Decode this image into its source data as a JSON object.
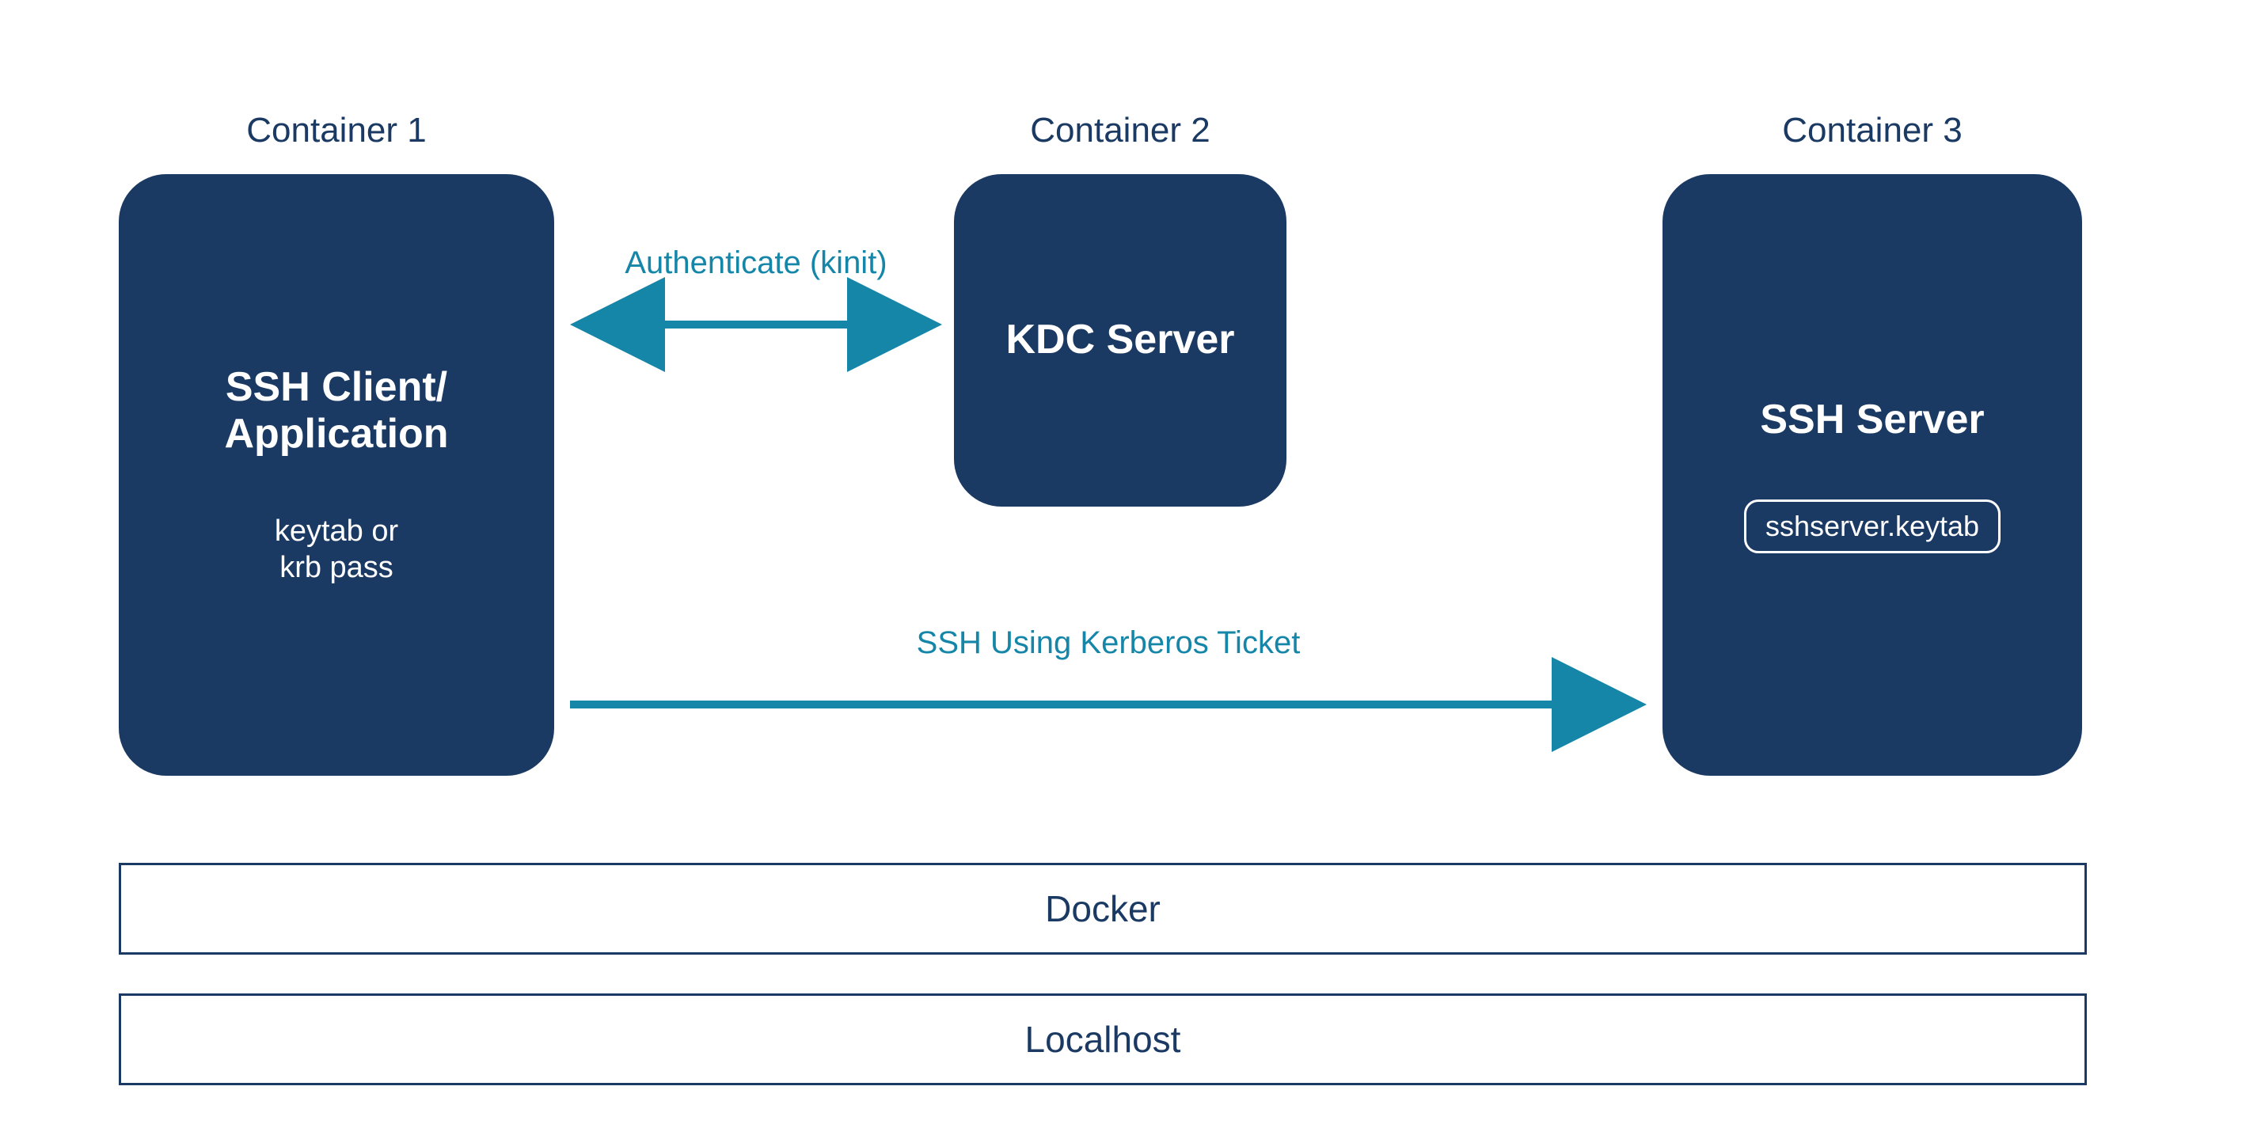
{
  "labels": {
    "container1": "Container 1",
    "container2": "Container 2",
    "container3": "Container 3"
  },
  "nodes": {
    "client": {
      "title_l1": "SSH Client/",
      "title_l2": "Application",
      "sub_l1": "keytab or",
      "sub_l2": "krb pass"
    },
    "kdc": {
      "title": "KDC Server"
    },
    "sshserver": {
      "title": "SSH Server",
      "chip": "sshserver.keytab"
    }
  },
  "arrows": {
    "auth": "Authenticate (kinit)",
    "ssh": "SSH Using Kerberos Ticket"
  },
  "layers": {
    "docker": "Docker",
    "localhost": "Localhost"
  },
  "colors": {
    "navy": "#1b3a63",
    "teal": "#1586a8"
  }
}
